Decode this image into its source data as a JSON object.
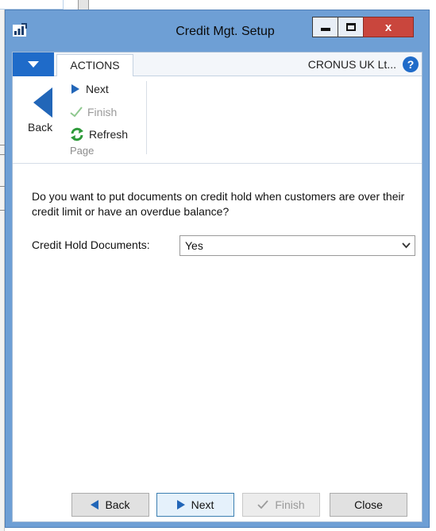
{
  "window": {
    "title": "Credit Mgt. Setup",
    "close_glyph": "x"
  },
  "tabs": {
    "actions_label": "ACTIONS",
    "company": "CRONUS UK Lt...",
    "help_glyph": "?"
  },
  "ribbon": {
    "back_label": "Back",
    "next_label": "Next",
    "finish_label": "Finish",
    "refresh_label": "Refresh",
    "group_label": "Page"
  },
  "main": {
    "question": "Do you want to put documents on credit hold when customers are over their credit limit or have an overdue balance?",
    "field_label": "Credit Hold Documents:",
    "field_value": "Yes"
  },
  "footer": {
    "back_label": "Back",
    "next_label": "Next",
    "finish_label": "Finish",
    "close_label": "Close"
  },
  "colors": {
    "titlebar": "#6e9fd5",
    "accent": "#1f6bc9",
    "close_button": "#c9463d",
    "arrow": "#2266b8",
    "refresh": "#2e9a3a",
    "check_disabled": "#8fc88f"
  },
  "icons": {
    "app": "dynamics-nav-icon",
    "back": "back-arrow-icon",
    "next": "next-arrow-icon",
    "finish": "checkmark-icon",
    "refresh": "refresh-icon",
    "help": "help-icon",
    "dropdown": "chevron-down-icon"
  }
}
